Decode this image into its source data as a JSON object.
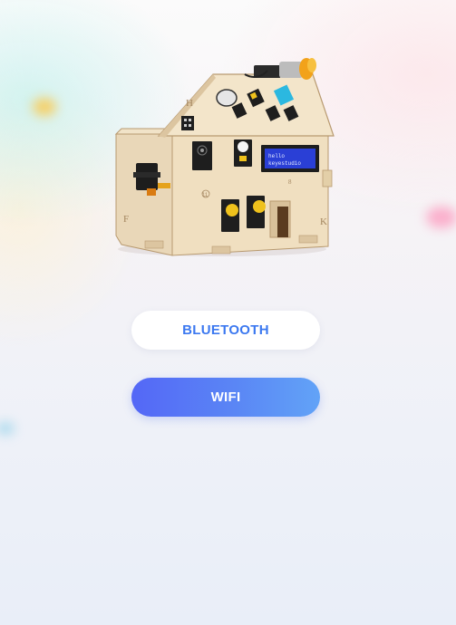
{
  "hero": {
    "image_name": "smart-home-kit-house-image",
    "lcd_line1": "hello",
    "lcd_line2": "keyestudio",
    "panel_letters": [
      "H",
      "F",
      "K",
      "8",
      "11"
    ]
  },
  "buttons": {
    "bluetooth_label": "BLUETOOTH",
    "wifi_label": "WIFI"
  },
  "colors": {
    "accent_blue": "#3b78f0",
    "wifi_gradient_start": "#5467f6",
    "wifi_gradient_end": "#62a3f7",
    "lcd_blue": "#2a3fd6"
  }
}
